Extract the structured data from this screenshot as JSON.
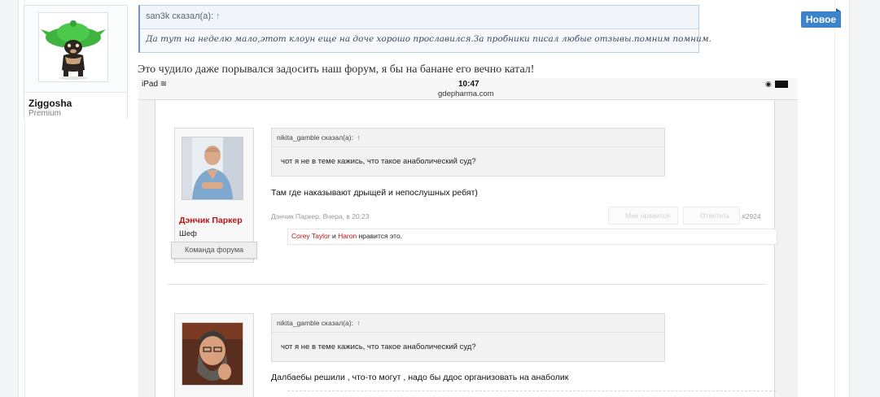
{
  "user": {
    "name": "Ziggosha",
    "title": "Premium"
  },
  "quote": {
    "author": "san3k сказал(а):",
    "arrow": "↑",
    "text": "Да тут на неделю мало,этот клоун еще на доче хорошо прославился.За пробники писал любые отзывы.помним помним."
  },
  "message": {
    "text": "Это чудило даже порывался задосить наш форум, я бы на банане его вечно катал!"
  },
  "badge": {
    "label": "Новое",
    "color": "#3b84c9"
  },
  "screenshot": {
    "device": "iPad",
    "time": "10:47",
    "url": "gdepharma.com",
    "posts": [
      {
        "author": "Дэнчик Паркер",
        "role": "Шеф",
        "team": "Команда форума",
        "quote_author": "nikita_gamble сказал(а):",
        "quote_arrow": "↑",
        "quote_text": "чот я не в теме кажись, что такое анаболический суд?",
        "text": "Там где наказывают дрыщей и непослушных ребят)",
        "meta": "Дэнчик Паркер, Вчера, в 20:23",
        "like_label": "Мне нравится",
        "reply_label": "Ответить",
        "post_number": "#2924",
        "likes": {
          "user1": "Corey Taylor",
          "and": "и",
          "user2": "Haron",
          "suffix": "нравится это."
        }
      },
      {
        "quote_author": "nikita_gamble сказал(а):",
        "quote_arrow": "↑",
        "quote_text": "чот я не в теме кажись, что такое анаболический суд?",
        "text": "Далбаебы решили , что-то могут , надо бы ддос организовать на анаболик"
      }
    ]
  }
}
